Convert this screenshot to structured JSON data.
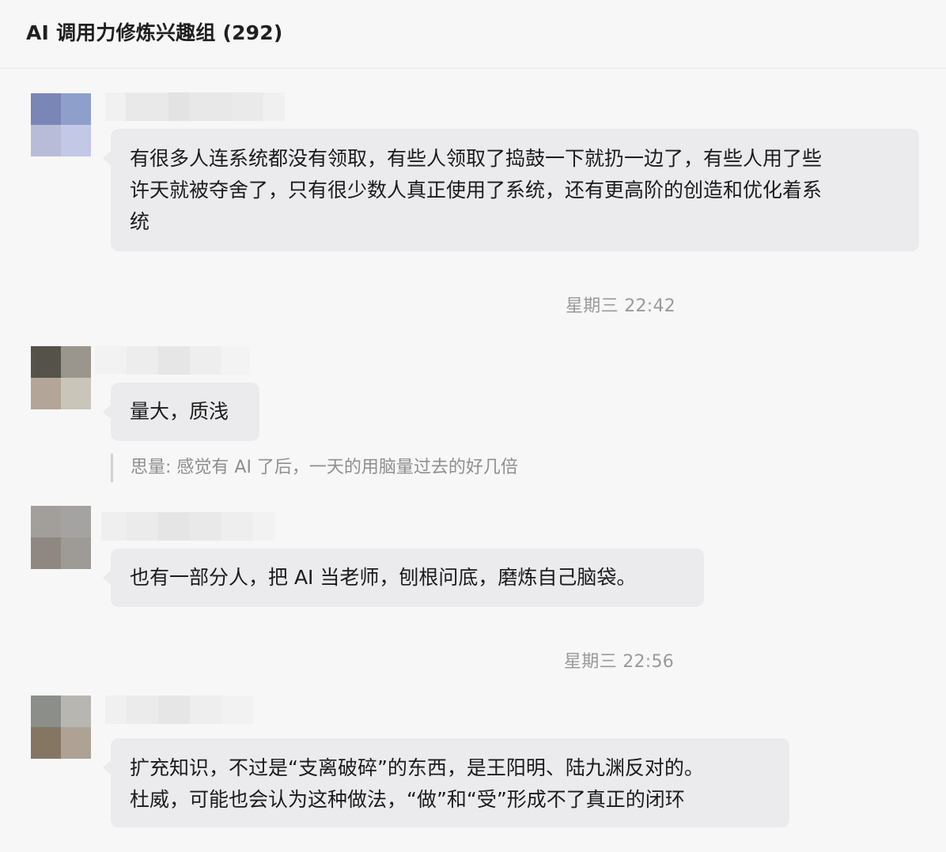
{
  "header": {
    "title": "AI 调用力修炼兴趣组 (292)"
  },
  "messages": [
    {
      "text": "有很多人连系统都没有领取，有些人领取了捣鼓一下就扔一边了，有些人用了些\n许天就被夺舍了，只有很少数人真正使用了系统，还有更高阶的创造和优化着系\n统"
    },
    {
      "text": "量大，质浅",
      "quote": "思量: 感觉有 AI 了后，一天的用脑量过去的好几倍"
    },
    {
      "text": "也有一部分人，把 AI 当老师，刨根问底，磨炼自己脑袋。"
    },
    {
      "text": "扩充知识，不过是“支离破碎”的东西，是王阳明、陆九渊反对的。\n杜威，可能也会认为这种做法，“做”和“受”形成不了真正的闭环"
    }
  ],
  "timestamps": [
    "星期三 22:42",
    "星期三 22:56"
  ],
  "colors": {
    "background": "#f7f7f7",
    "bubble": "#ebebed",
    "timestamp": "#9a9a9a",
    "quote_text": "#8f8f8f"
  },
  "avatars": [
    [
      "#7a86b6",
      "#8e9fcb",
      "#b9bcd8",
      "#c3c8e6"
    ],
    [
      "#55524a",
      "#9b968d",
      "#b3a698",
      "#c9c6b9"
    ],
    [
      "#a29e99",
      "#a5a3a1",
      "#8f8882",
      "#9e9b97"
    ],
    [
      "#8c8f89",
      "#b8b6b1",
      "#857664",
      "#ada294"
    ]
  ],
  "name_blurs": [
    [
      "#f1f1f1",
      "#e9e9e9",
      "#e3e3e3",
      "#e8e8e8",
      "#eaeaea",
      "#f0f0f0"
    ],
    [
      "#f2f2f2",
      "#ededed",
      "#e6e6e6",
      "#eeeeee",
      "#f3f3f3"
    ],
    [
      "#efefef",
      "#ebebeb",
      "#e5e5e5",
      "#e9e9e9",
      "#eeeeee",
      "#f2f2f2"
    ],
    [
      "#f0f0f0",
      "#ebebeb",
      "#e6e6e6",
      "#eeeeee",
      "#f2f2f2"
    ]
  ]
}
